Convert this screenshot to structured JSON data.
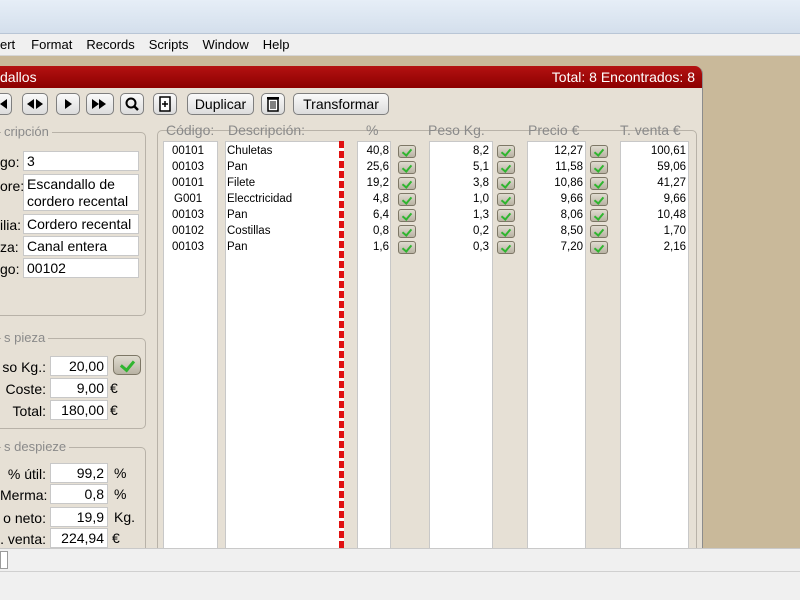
{
  "menu": [
    "ert",
    "Format",
    "Records",
    "Scripts",
    "Window",
    "Help"
  ],
  "window": {
    "title": "dallos",
    "status": "Total: 8 Encontrados: 8",
    "title_color": "#a00000"
  },
  "toolbar": {
    "duplicate_label": "Duplicar",
    "transform_label": "Transformar"
  },
  "description_group": {
    "title": "cripción",
    "fields": [
      {
        "label": "go:",
        "value": "3"
      },
      {
        "label": "ore:",
        "value": "Escandallo de cordero recental"
      },
      {
        "label": "ilia:",
        "value": "Cordero recental"
      },
      {
        "label": "za:",
        "value": "Canal entera"
      },
      {
        "label": "go:",
        "value": "00102"
      }
    ]
  },
  "pieza_group": {
    "title": "s pieza",
    "rows": [
      {
        "label": "so Kg.:",
        "value": "20,00",
        "unit": ""
      },
      {
        "label": "Coste:",
        "value": "9,00",
        "unit": "€"
      },
      {
        "label": "Total:",
        "value": "180,00",
        "unit": "€"
      }
    ]
  },
  "despiece_group": {
    "title": "s despieze",
    "rows": [
      {
        "label": "% útil:",
        "value": "99,2",
        "unit": "%"
      },
      {
        "label": "Merma:",
        "value": "0,8",
        "unit": "%"
      },
      {
        "label": "o neto:",
        "value": "19,9",
        "unit": "Kg."
      },
      {
        "label": ". venta:",
        "value": "224,94",
        "unit": "€"
      }
    ]
  },
  "table": {
    "headers": {
      "codigo": "Código:",
      "descripcion": "Descripción:",
      "pct": "%",
      "peso": "Peso Kg.",
      "precio": "Precio €",
      "tventa": "T. venta €"
    },
    "rows": [
      {
        "codigo": "00101",
        "descripcion": "Chuletas",
        "pct": "40,8",
        "peso": "8,2",
        "precio": "12,27",
        "tventa": "100,61"
      },
      {
        "codigo": "00103",
        "descripcion": "Pan",
        "pct": "25,6",
        "peso": "5,1",
        "precio": "11,58",
        "tventa": "59,06"
      },
      {
        "codigo": "00101",
        "descripcion": "Filete",
        "pct": "19,2",
        "peso": "3,8",
        "precio": "10,86",
        "tventa": "41,27"
      },
      {
        "codigo": "G001",
        "descripcion": "Elecctricidad",
        "pct": "4,8",
        "peso": "1,0",
        "precio": "9,66",
        "tventa": "9,66"
      },
      {
        "codigo": "00103",
        "descripcion": "Pan",
        "pct": "6,4",
        "peso": "1,3",
        "precio": "8,06",
        "tventa": "10,48"
      },
      {
        "codigo": "00102",
        "descripcion": "Costillas",
        "pct": "0,8",
        "peso": "0,2",
        "precio": "8,50",
        "tventa": "1,70"
      },
      {
        "codigo": "00103",
        "descripcion": "Pan",
        "pct": "1,6",
        "peso": "0,3",
        "precio": "7,20",
        "tventa": "2,16"
      }
    ]
  }
}
